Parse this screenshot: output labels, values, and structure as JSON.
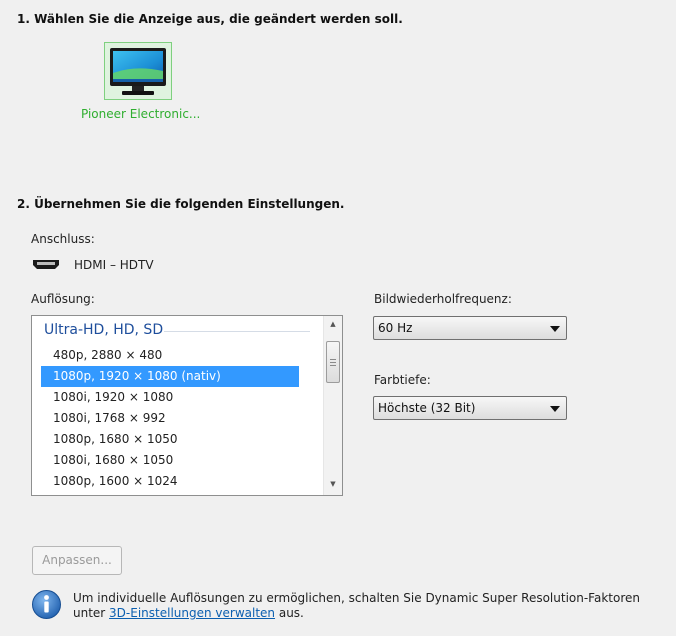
{
  "section1": {
    "title": "1. Wählen Sie die Anzeige aus, die geändert werden soll."
  },
  "display": {
    "name": "Pioneer Electronic...",
    "icon": "monitor-icon",
    "highlight_color": "#2fae2f"
  },
  "section2": {
    "title": "2. Übernehmen Sie die folgenden Einstellungen."
  },
  "connection": {
    "label": "Anschluss:",
    "value": "HDMI – HDTV",
    "icon": "hdmi-connector-icon"
  },
  "resolution": {
    "label": "Auflösung:",
    "group_header": "Ultra-HD, HD, SD",
    "items": [
      "480p, 2880 × 480",
      "1080p, 1920 × 1080 (nativ)",
      "1080i, 1920 × 1080",
      "1080i, 1768 × 992",
      "1080p, 1680 × 1050",
      "1080i, 1680 × 1050",
      "1080p, 1600 × 1024"
    ],
    "selected_index": 1,
    "selection_color": "#3399ff"
  },
  "refresh_rate": {
    "label": "Bildwiederholfrequenz:",
    "value": "60 Hz"
  },
  "color_depth": {
    "label": "Farbtiefe:",
    "value": "Höchste (32 Bit)"
  },
  "apply_button": {
    "label": "Anpassen...",
    "enabled": false
  },
  "info": {
    "icon": "info-icon",
    "text_before": "Um individuelle Auflösungen zu ermöglichen, schalten Sie Dynamic Super Resolution-Faktoren unter ",
    "link_text": "3D-Einstellungen verwalten",
    "text_after": " aus.",
    "link_color": "#0b5fb0"
  }
}
